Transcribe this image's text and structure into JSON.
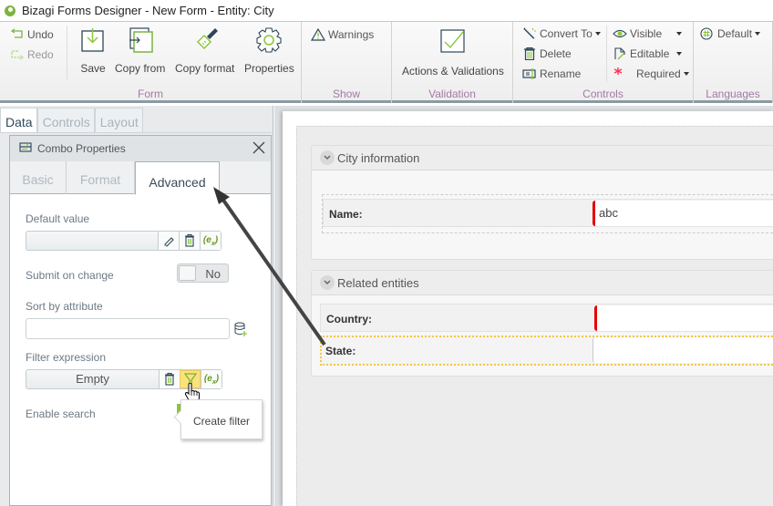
{
  "window": {
    "title": "Bizagi Forms Designer  - New Form - Entity:  City"
  },
  "ribbon": {
    "form_group": {
      "label": "Form",
      "undo": "Undo",
      "redo": "Redo",
      "save": "Save",
      "copy_from": "Copy from",
      "copy_format": "Copy format",
      "properties": "Properties"
    },
    "show_group": {
      "label": "Show",
      "warnings": "Warnings"
    },
    "validation_group": {
      "label": "Validation",
      "actions_validations": "Actions & Validations"
    },
    "controls_group": {
      "label": "Controls",
      "convert_to": "Convert To",
      "delete": "Delete",
      "rename": "Rename",
      "visible": "Visible",
      "editable": "Editable",
      "required": "Required"
    },
    "languages_group": {
      "label": "Languages",
      "language": "Default"
    }
  },
  "left_panel": {
    "tabs": [
      {
        "label": "Data",
        "active": true
      },
      {
        "label": "Controls",
        "active": false
      },
      {
        "label": "Layout",
        "active": false
      }
    ],
    "dialog": {
      "title": "Combo Properties",
      "tabs": [
        {
          "label": "Basic",
          "active": false
        },
        {
          "label": "Format",
          "active": false
        },
        {
          "label": "Advanced",
          "active": true
        }
      ],
      "fields": {
        "default_value": {
          "label": "Default value",
          "value": ""
        },
        "submit_on_change": {
          "label": "Submit on change",
          "value": "No"
        },
        "sort_by_attribute": {
          "label": "Sort by attribute",
          "value": ""
        },
        "filter_expression": {
          "label": "Filter expression",
          "value": "Empty"
        },
        "enable_search": {
          "label": "Enable search"
        }
      },
      "tooltip": "Create filter"
    }
  },
  "form": {
    "groups": [
      {
        "title": "City information",
        "fields": [
          {
            "label": "Name:",
            "value": "abc",
            "required": true
          }
        ]
      },
      {
        "title": "Related entities",
        "fields": [
          {
            "label": "Country:",
            "value": "",
            "required": true
          },
          {
            "label": "State:",
            "value": "",
            "required": false,
            "selected": true
          }
        ]
      }
    ]
  },
  "colors": {
    "accent_green": "#8dc63f",
    "required_red": "#e60000",
    "highlight_yellow": "#fbe27a",
    "group_label": "#a27aa4",
    "selection_dotted": "#f2c744"
  }
}
